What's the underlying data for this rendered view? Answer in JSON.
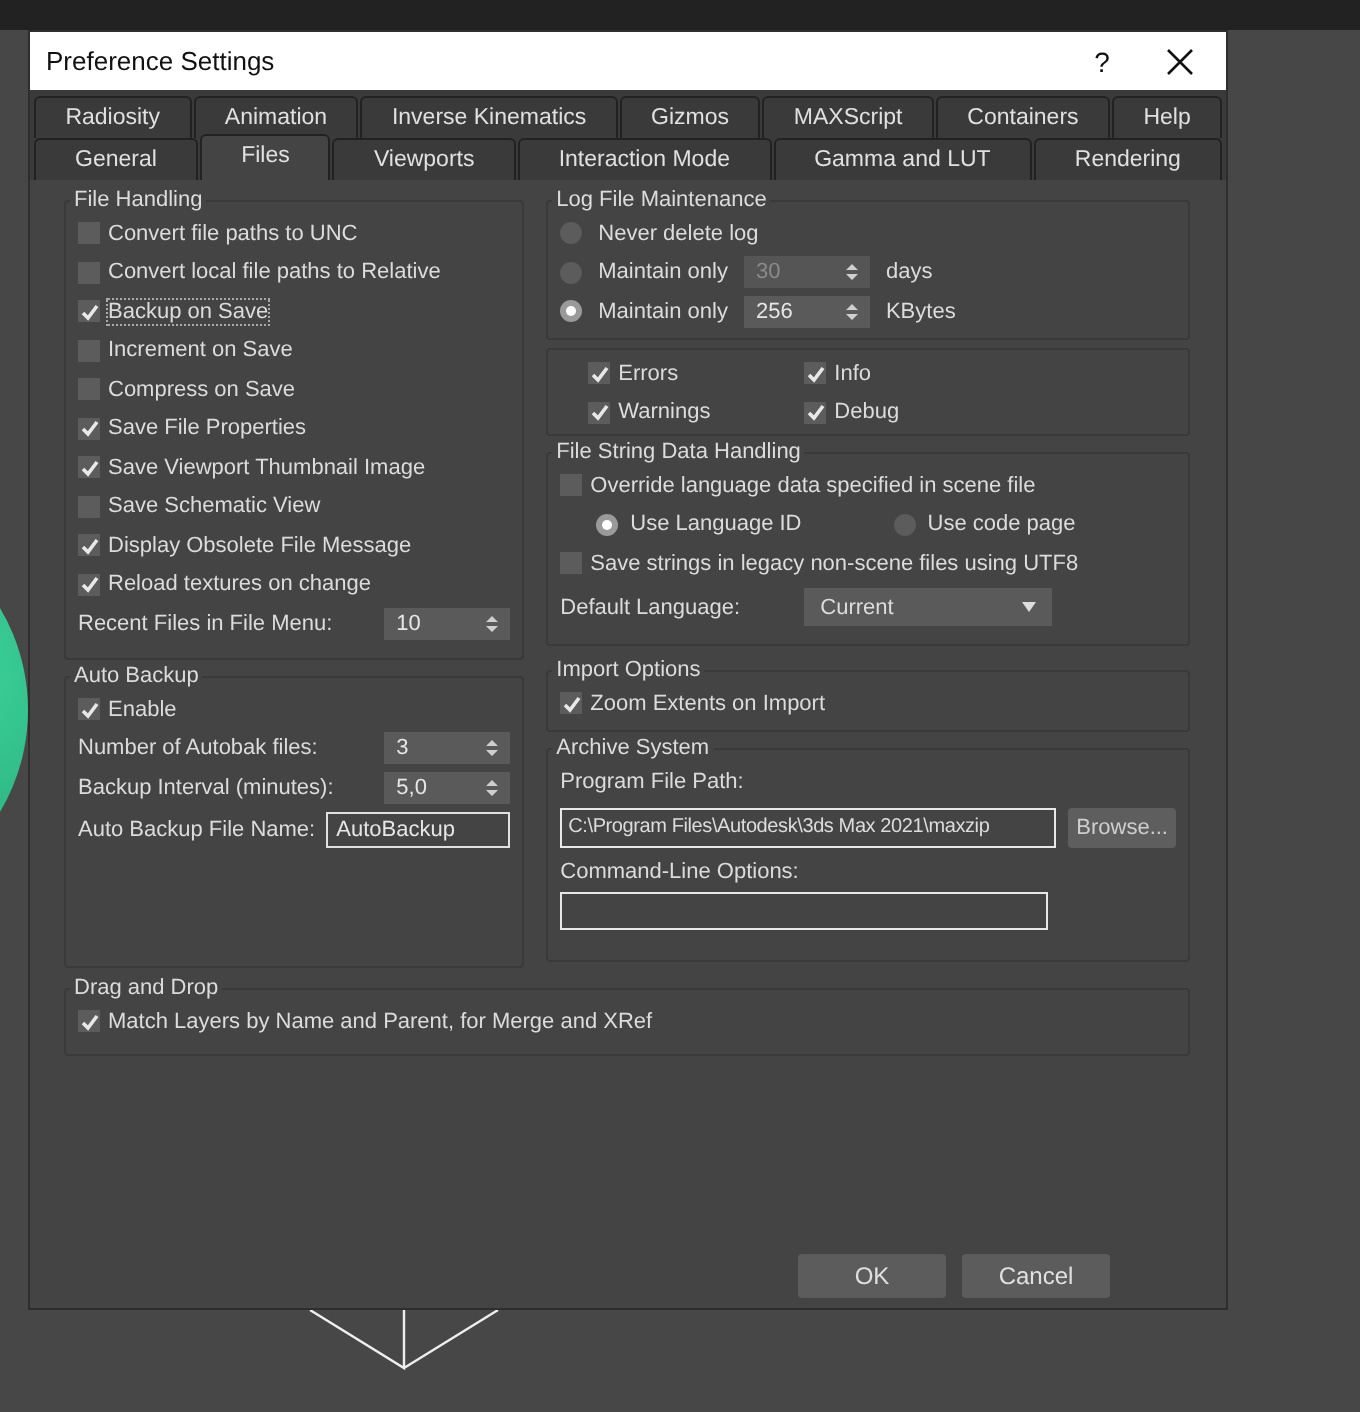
{
  "window": {
    "title": "Preference Settings",
    "help_button": "?"
  },
  "tab_rows": [
    {
      "tabs": [
        {
          "label": "Radiosity",
          "selected": false
        },
        {
          "label": "Animation",
          "selected": false
        },
        {
          "label": "Inverse Kinematics",
          "selected": false
        },
        {
          "label": "Gizmos",
          "selected": false
        },
        {
          "label": "MAXScript",
          "selected": false
        },
        {
          "label": "Containers",
          "selected": false
        },
        {
          "label": "Help",
          "selected": false
        }
      ]
    },
    {
      "tabs": [
        {
          "label": "General",
          "selected": false
        },
        {
          "label": "Files",
          "selected": true
        },
        {
          "label": "Viewports",
          "selected": false
        },
        {
          "label": "Interaction Mode",
          "selected": false
        },
        {
          "label": "Gamma and LUT",
          "selected": false
        },
        {
          "label": "Rendering",
          "selected": false
        }
      ]
    }
  ],
  "file_handling": {
    "title": "File Handling",
    "options": [
      {
        "label": "Convert file paths to UNC",
        "checked": false,
        "focused": false
      },
      {
        "label": "Convert local file paths to Relative",
        "checked": false,
        "focused": false
      },
      {
        "label": "Backup on Save",
        "checked": true,
        "focused": true
      },
      {
        "label": "Increment on Save",
        "checked": false,
        "focused": false
      },
      {
        "label": "Compress on Save",
        "checked": false,
        "focused": false
      },
      {
        "label": "Save File Properties",
        "checked": true,
        "focused": false
      },
      {
        "label": "Save Viewport Thumbnail Image",
        "checked": true,
        "focused": false
      },
      {
        "label": "Save Schematic View",
        "checked": false,
        "focused": false
      },
      {
        "label": "Display Obsolete File Message",
        "checked": true,
        "focused": false
      },
      {
        "label": "Reload textures on change",
        "checked": true,
        "focused": false
      }
    ],
    "recent_files": {
      "label": "Recent Files in File Menu:",
      "value": "10"
    }
  },
  "auto_backup": {
    "title": "Auto Backup",
    "enable": {
      "label": "Enable",
      "checked": true
    },
    "fields": [
      {
        "kind": "spinner",
        "label": "Number of Autobak files:",
        "value": "3"
      },
      {
        "kind": "spinner",
        "label": "Backup Interval (minutes):",
        "value": "5,0"
      },
      {
        "kind": "text",
        "label": "Auto Backup File Name:",
        "value": "AutoBackup"
      }
    ]
  },
  "log_file_maintenance": {
    "title": "Log File Maintenance",
    "options": [
      {
        "label": "Never delete log",
        "selected": false
      },
      {
        "label": "Maintain only",
        "selected": false,
        "value": "30",
        "disabled": true,
        "unit": "days"
      },
      {
        "label": "Maintain only",
        "selected": true,
        "value": "256",
        "disabled": false,
        "unit": "KBytes"
      }
    ]
  },
  "log_levels": [
    {
      "label": "Errors",
      "checked": true
    },
    {
      "label": "Info",
      "checked": true
    },
    {
      "label": "Warnings",
      "checked": true
    },
    {
      "label": "Debug",
      "checked": true
    }
  ],
  "file_string_data_handling": {
    "title": "File String Data Handling",
    "override": {
      "label": "Override language data specified in scene file",
      "checked": false
    },
    "encoding": [
      {
        "label": "Use Language ID",
        "selected": true
      },
      {
        "label": "Use code page",
        "selected": false
      }
    ],
    "utf8": {
      "label": "Save strings in legacy non-scene files using UTF8",
      "checked": false
    },
    "default_language": {
      "label": "Default Language:",
      "value": "Current"
    }
  },
  "import_options": {
    "title": "Import Options",
    "options": [
      {
        "label": "Zoom Extents on Import",
        "checked": true
      }
    ]
  },
  "archive_system": {
    "title": "Archive System",
    "program_file_path": {
      "label": "Program File Path:",
      "value": "C:\\Program Files\\Autodesk\\3ds Max 2021\\maxzip"
    },
    "browse_button": "Browse...",
    "command_line_options": {
      "label": "Command-Line Options:"
    }
  },
  "drag_and_drop": {
    "title": "Drag and Drop",
    "options": [
      {
        "label": "Match Layers by Name and Parent, for Merge and XRef",
        "checked": true
      }
    ]
  },
  "buttons": [
    "OK",
    "Cancel"
  ]
}
